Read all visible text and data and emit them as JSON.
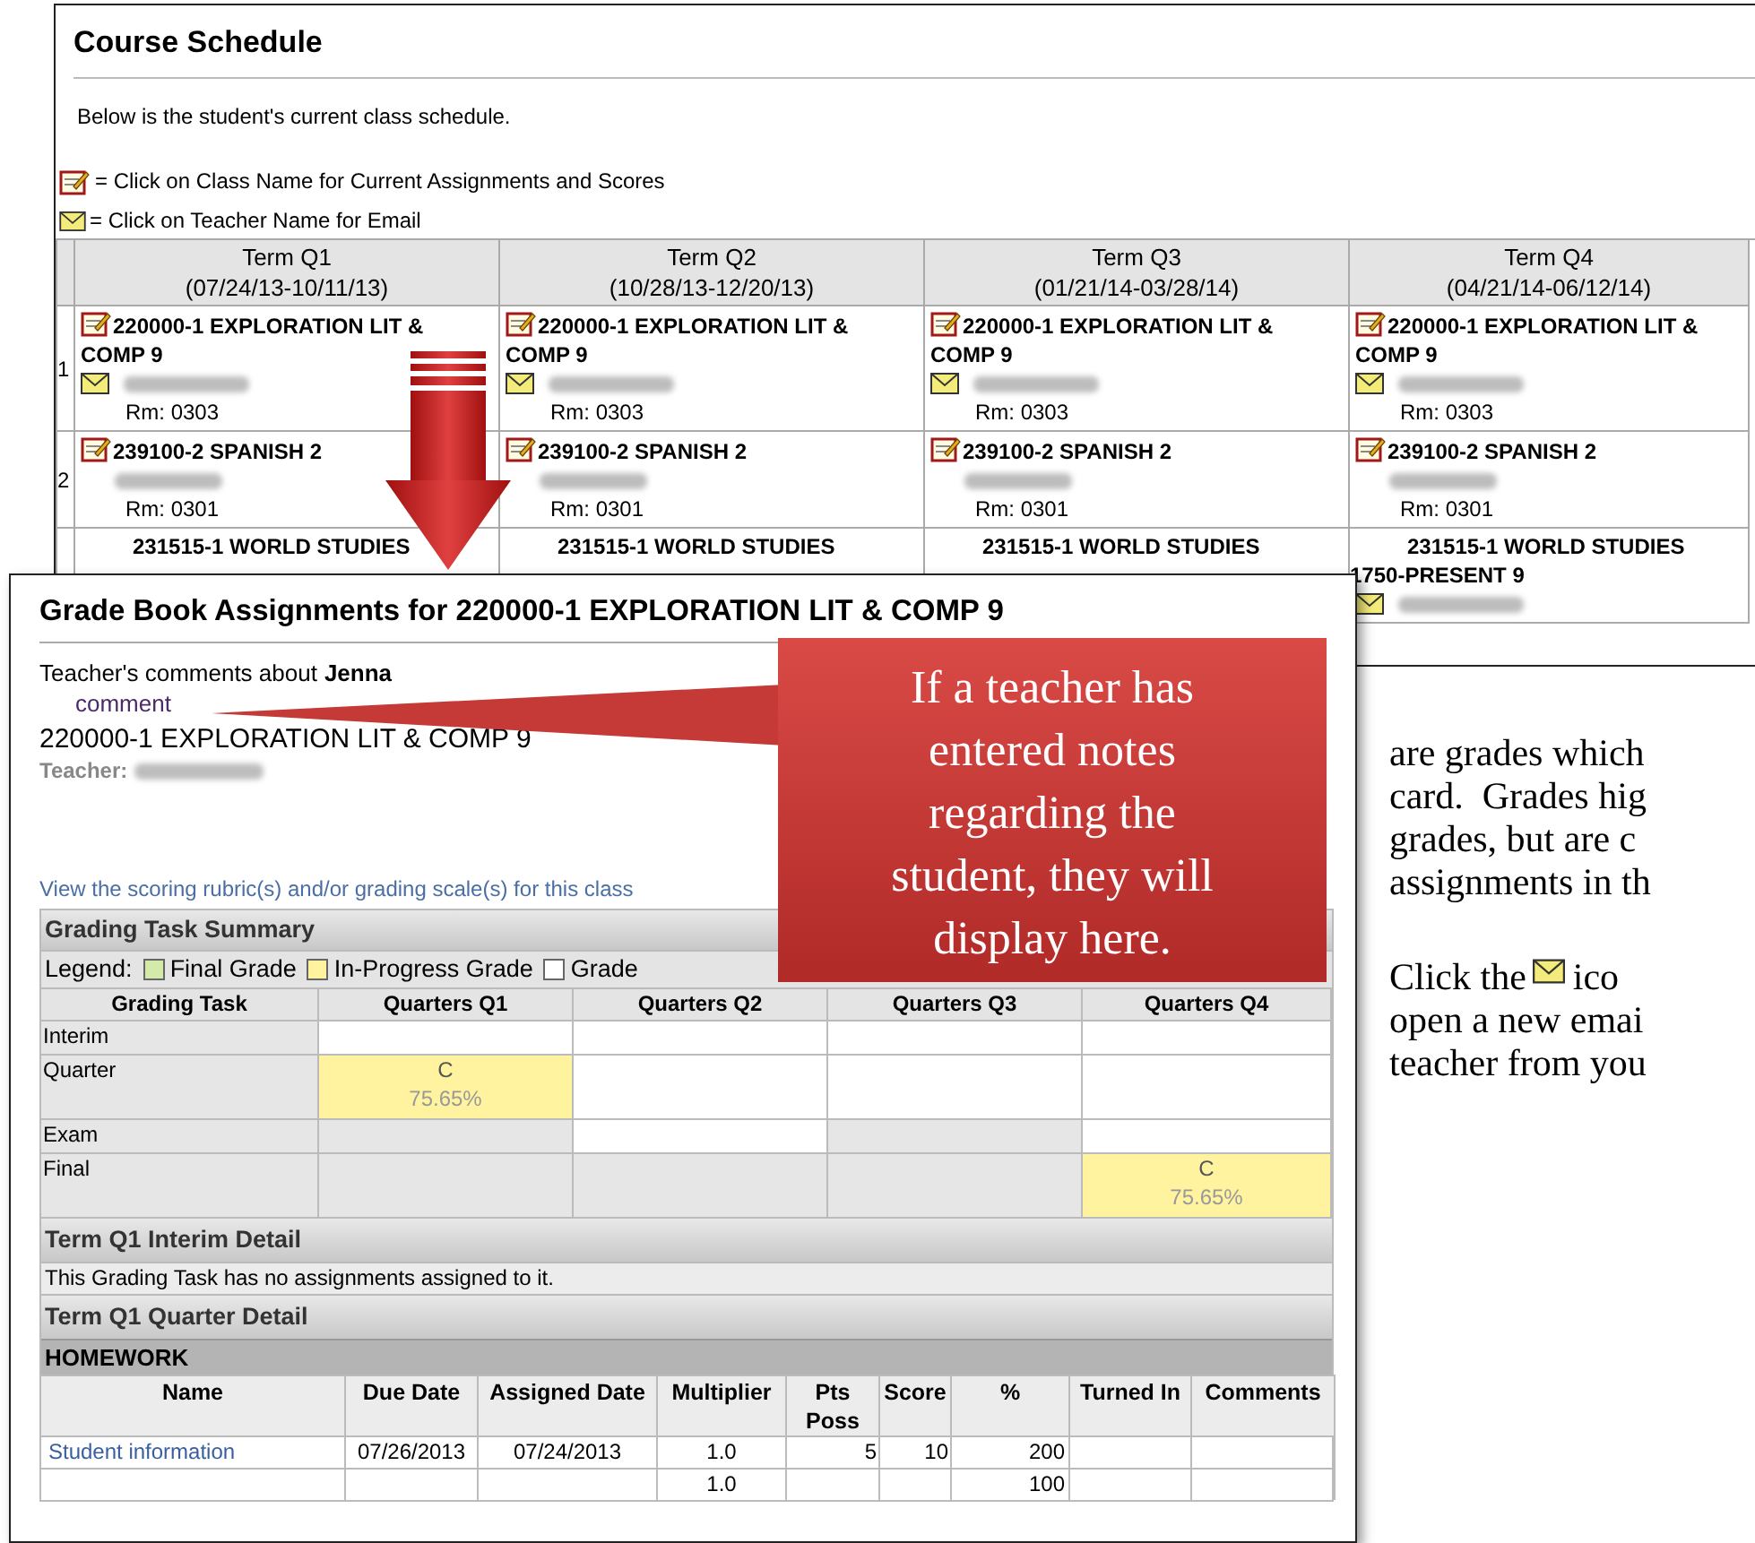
{
  "schedule": {
    "title": "Course Schedule",
    "intro": "Below is the student's current class schedule.",
    "legend": [
      {
        "kind": "assignments",
        "text": "= Click on Class Name for Current Assignments and Scores"
      },
      {
        "kind": "email",
        "text": "= Click on Teacher Name for Email"
      }
    ],
    "terms": [
      {
        "name": "Term Q1",
        "dates": "(07/24/13-10/11/13)"
      },
      {
        "name": "Term Q2",
        "dates": "(10/28/13-12/20/13)"
      },
      {
        "name": "Term Q3",
        "dates": "(01/21/14-03/28/14)"
      },
      {
        "name": "Term Q4",
        "dates": "(04/21/14-06/12/14)"
      }
    ],
    "rows": [
      {
        "number": "1",
        "cells": [
          {
            "course": "220000-1 EXPLORATION LIT & COMP 9",
            "icon": true,
            "email": true,
            "room": "Rm: 0303"
          },
          {
            "course": "220000-1 EXPLORATION LIT & COMP 9",
            "icon": true,
            "email": true,
            "room": "Rm: 0303"
          },
          {
            "course": "220000-1 EXPLORATION LIT & COMP 9",
            "icon": true,
            "email": true,
            "room": "Rm: 0303"
          },
          {
            "course": "220000-1 EXPLORATION LIT & COMP 9",
            "icon": true,
            "email": true,
            "room": "Rm: 0303"
          }
        ]
      },
      {
        "number": "2",
        "cells": [
          {
            "course": "239100-2 SPANISH 2",
            "icon": true,
            "email": false,
            "room": "Rm: 0301"
          },
          {
            "course": "239100-2 SPANISH 2",
            "icon": true,
            "email": false,
            "room": "Rm: 0301"
          },
          {
            "course": "239100-2 SPANISH 2",
            "icon": true,
            "email": false,
            "room": "Rm: 0301"
          },
          {
            "course": "239100-2 SPANISH 2",
            "icon": true,
            "email": false,
            "room": "Rm: 0301"
          }
        ]
      },
      {
        "cells": [
          {
            "course": "231515-1 WORLD STUDIES",
            "icon": false
          },
          {
            "course": "231515-1 WORLD STUDIES",
            "icon": false
          },
          {
            "course": "231515-1 WORLD STUDIES",
            "icon": false
          },
          {
            "course": "231515-1 WORLD STUDIES",
            "course_line2": "1750-PRESENT 9",
            "icon": false,
            "email": true
          }
        ]
      }
    ]
  },
  "gradebook": {
    "title": "Grade Book Assignments for 220000-1 EXPLORATION LIT & COMP 9",
    "comments_label": "Teacher's comments about",
    "student": "Jenna",
    "comment": "comment",
    "course": "220000-1 EXPLORATION LIT & COMP 9",
    "teacher_label": "Teacher:",
    "rubric_link": "View the scoring rubric(s) and/or grading scale(s) for this class",
    "summary_title": "Grading Task Summary",
    "legend_label": "Legend:",
    "legend": [
      {
        "text": "Final Grade",
        "color": "#d4eaa8"
      },
      {
        "text": "In-Progress Grade",
        "color": "#fff3a0"
      },
      {
        "text": "Grade",
        "color": "#ffffff"
      }
    ],
    "columns": [
      "Grading Task",
      "Quarters Q1",
      "Quarters Q2",
      "Quarters Q3",
      "Quarters Q4"
    ],
    "tasks": [
      {
        "name": "Interim",
        "cells": [
          {
            "kind": "open"
          },
          {
            "kind": "open"
          },
          {
            "kind": "open"
          },
          {
            "kind": "open"
          }
        ]
      },
      {
        "name": "Quarter",
        "cells": [
          {
            "kind": "in_progress",
            "grade": "C",
            "percent": "75.65%"
          },
          {
            "kind": "open"
          },
          {
            "kind": "open"
          },
          {
            "kind": "open"
          }
        ]
      },
      {
        "name": "Exam",
        "cells": [
          {
            "kind": "locked"
          },
          {
            "kind": "open"
          },
          {
            "kind": "locked"
          },
          {
            "kind": "open"
          }
        ]
      },
      {
        "name": "Final",
        "cells": [
          {
            "kind": "locked"
          },
          {
            "kind": "locked"
          },
          {
            "kind": "locked"
          },
          {
            "kind": "in_progress",
            "grade": "C",
            "percent": "75.65%"
          }
        ]
      }
    ],
    "interim_detail": {
      "title": "Term Q1 Interim Detail",
      "message": "This Grading Task has no assignments assigned to it."
    },
    "quarter_detail": {
      "title": "Term Q1 Quarter Detail",
      "category": "HOMEWORK",
      "columns": [
        "Name",
        "Due Date",
        "Assigned Date",
        "Multiplier",
        "Pts Poss",
        "Score",
        "%",
        "Turned In",
        "Comments"
      ],
      "rows": [
        {
          "name": "Student information",
          "due": "07/26/2013",
          "assigned": "07/24/2013",
          "multiplier": "1.0",
          "pts": "5",
          "score": "10",
          "percent": "200"
        },
        {
          "multiplier": "1.0",
          "percent": "100"
        }
      ]
    }
  },
  "callout": {
    "text": "If a teacher has entered notes regarding the student, they will display here."
  },
  "document": {
    "paragraph": [
      "are grades which",
      "card.  Grades hig",
      "grades, but are c",
      "assignments in th"
    ],
    "click_lead": "Click the",
    "click_trail": "ico",
    "lines": [
      "open a new emai",
      "teacher from you"
    ]
  }
}
